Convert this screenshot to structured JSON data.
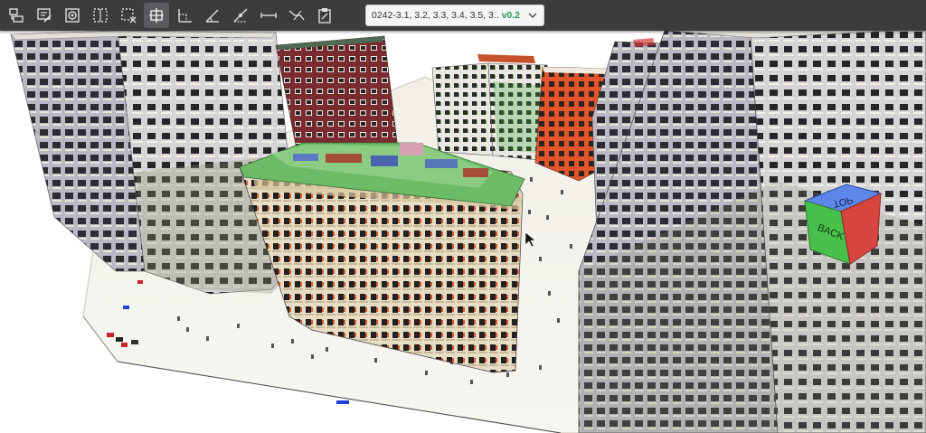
{
  "toolbar": {
    "tools": [
      {
        "name": "properties-tool-icon"
      },
      {
        "name": "markup-tool-icon"
      },
      {
        "name": "isolate-tool-icon"
      },
      {
        "name": "section-box-tool-icon"
      },
      {
        "name": "section-box-clear-icon"
      },
      {
        "name": "section-plane-tool-icon"
      },
      {
        "name": "measure-point-icon"
      },
      {
        "name": "measure-angle-icon"
      },
      {
        "name": "measure-slope-icon"
      },
      {
        "name": "measure-distance-icon"
      },
      {
        "name": "measure-path-icon"
      },
      {
        "name": "clipboard-tool-icon"
      }
    ]
  },
  "model_select": {
    "value": "0242-3.1, 3.2, 3.3, 3.4, 3.5, 3...",
    "version": "v0.2"
  },
  "view_cube": {
    "top_label": "TOP",
    "back_label": "BACK"
  },
  "colors": {
    "toolbar_bg": "#3b3c3e",
    "version_green": "#2e9b57",
    "cube_top": "#5d86e8",
    "cube_back": "#49c04b",
    "cube_side": "#d6463f"
  }
}
